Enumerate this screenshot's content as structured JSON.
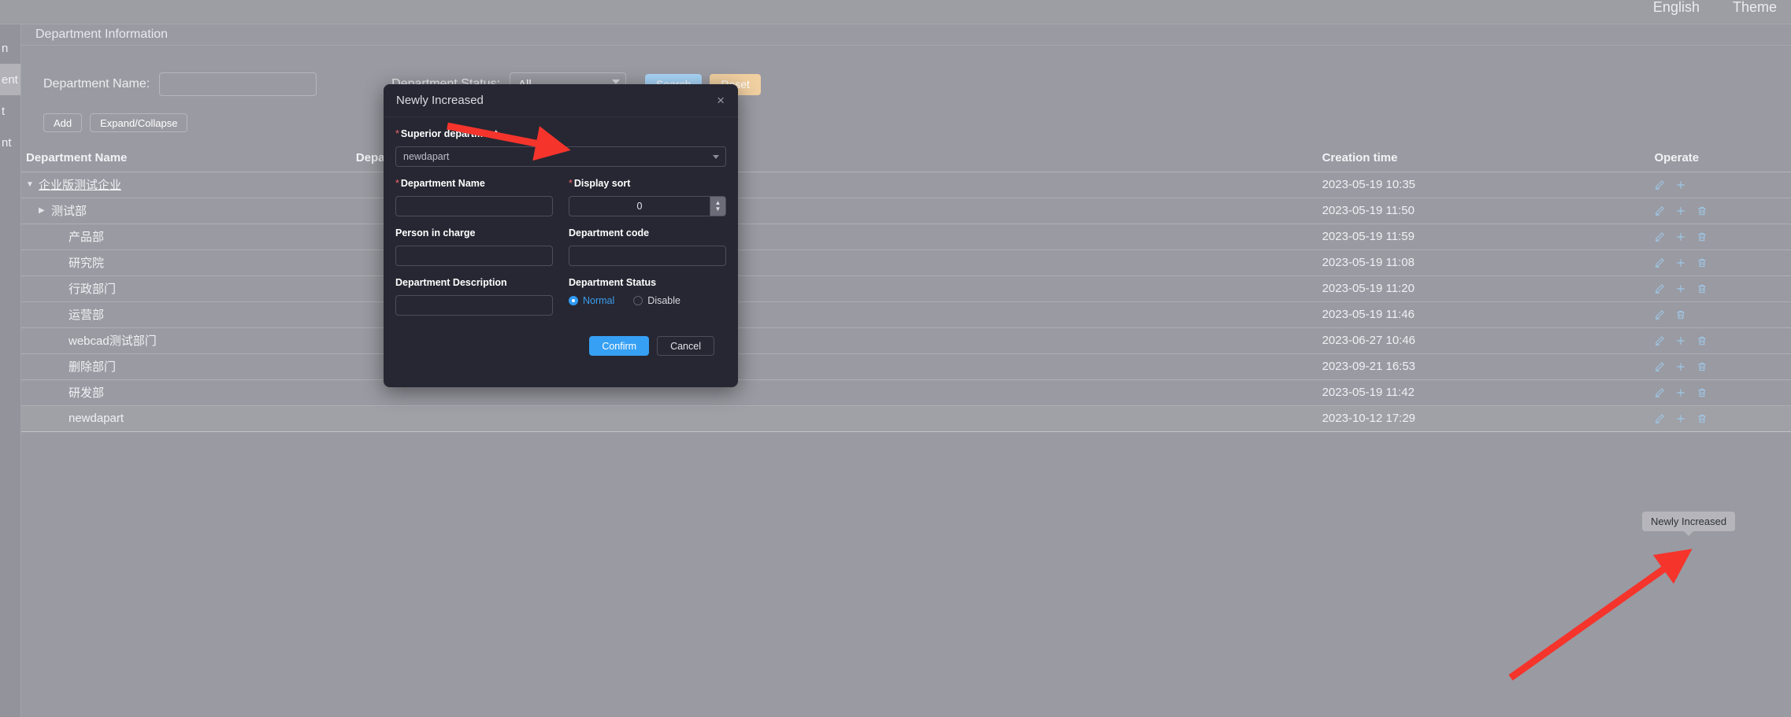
{
  "topbar": {
    "language": "English",
    "theme": "Theme"
  },
  "sidebar": {
    "items": [
      {
        "label": "n",
        "active": false
      },
      {
        "label": "ent",
        "active": true
      },
      {
        "label": "t",
        "active": false
      },
      {
        "label": "nt",
        "active": false
      }
    ]
  },
  "panel": {
    "title": "Department Information"
  },
  "filters": {
    "name_label": "Department Name:",
    "name_value": "",
    "name_placeholder": "",
    "status_label": "Department Status:",
    "status_value": "All",
    "search_label": "Search",
    "reset_label": "Reset"
  },
  "toolbar": {
    "add_label": "Add",
    "expand_label": "Expand/Collapse"
  },
  "table": {
    "columns": [
      "Department Name",
      "Department Code",
      "Creation time",
      "Operate"
    ],
    "rows": [
      {
        "name": "企业版测试企业",
        "indent": 0,
        "caret": "down",
        "link": true,
        "code": "",
        "time": "2023-05-19 10:35",
        "ops": [
          "edit",
          "add"
        ],
        "highlight": false
      },
      {
        "name": "测试部",
        "indent": 1,
        "caret": "right",
        "link": false,
        "code": "",
        "time": "2023-05-19 11:50",
        "ops": [
          "edit",
          "add",
          "delete"
        ],
        "highlight": false
      },
      {
        "name": "产品部",
        "indent": 2,
        "caret": "none",
        "link": false,
        "code": "",
        "time": "2023-05-19 11:59",
        "ops": [
          "edit",
          "add",
          "delete"
        ],
        "highlight": false
      },
      {
        "name": "研究院",
        "indent": 2,
        "caret": "none",
        "link": false,
        "code": "",
        "time": "2023-05-19 11:08",
        "ops": [
          "edit",
          "add",
          "delete"
        ],
        "highlight": false
      },
      {
        "name": "行政部门",
        "indent": 2,
        "caret": "none",
        "link": false,
        "code": "",
        "time": "2023-05-19 11:20",
        "ops": [
          "edit",
          "add",
          "delete"
        ],
        "highlight": false
      },
      {
        "name": "运营部",
        "indent": 2,
        "caret": "none",
        "link": false,
        "code": "",
        "time": "2023-05-19 11:46",
        "ops": [
          "edit",
          "delete"
        ],
        "highlight": false
      },
      {
        "name": "webcad测试部门",
        "indent": 2,
        "caret": "none",
        "link": false,
        "code": "",
        "time": "2023-06-27 10:46",
        "ops": [
          "edit",
          "add",
          "delete"
        ],
        "highlight": false
      },
      {
        "name": "删除部门",
        "indent": 2,
        "caret": "none",
        "link": false,
        "code": "",
        "time": "2023-09-21 16:53",
        "ops": [
          "edit",
          "add",
          "delete"
        ],
        "highlight": false
      },
      {
        "name": "研发部",
        "indent": 2,
        "caret": "none",
        "link": false,
        "code": "",
        "time": "2023-05-19 11:42",
        "ops": [
          "edit",
          "add",
          "delete"
        ],
        "highlight": false
      },
      {
        "name": "newdapart",
        "indent": 2,
        "caret": "none",
        "link": false,
        "code": "",
        "time": "2023-10-12 17:29",
        "ops": [
          "edit",
          "add",
          "delete"
        ],
        "highlight": true
      }
    ]
  },
  "modal": {
    "title": "Newly Increased",
    "close_icon": "×",
    "superior_label": "Superior department",
    "superior_value": "newdapart",
    "dept_name_label": "Department Name",
    "dept_name_value": "",
    "display_sort_label": "Display sort",
    "display_sort_value": "0",
    "person_label": "Person in charge",
    "person_value": "",
    "dept_code_label": "Department code",
    "dept_code_value": "",
    "desc_label": "Department Description",
    "desc_value": "",
    "status_label": "Department Status",
    "status_options": [
      {
        "label": "Normal",
        "selected": true
      },
      {
        "label": "Disable",
        "selected": false
      }
    ],
    "confirm_label": "Confirm",
    "cancel_label": "Cancel"
  },
  "tooltip": {
    "text": "Newly Increased"
  },
  "colors": {
    "page_bg": "#9a9aa2",
    "modal_bg": "#262732",
    "accent_blue": "#36a0f4",
    "search_blue": "#a8d4f7",
    "reset_orange": "#f0cfa0",
    "required_red": "#f0656c",
    "op_icon_blue": "#9ec8e8",
    "arrow_red": "#f5342c"
  }
}
